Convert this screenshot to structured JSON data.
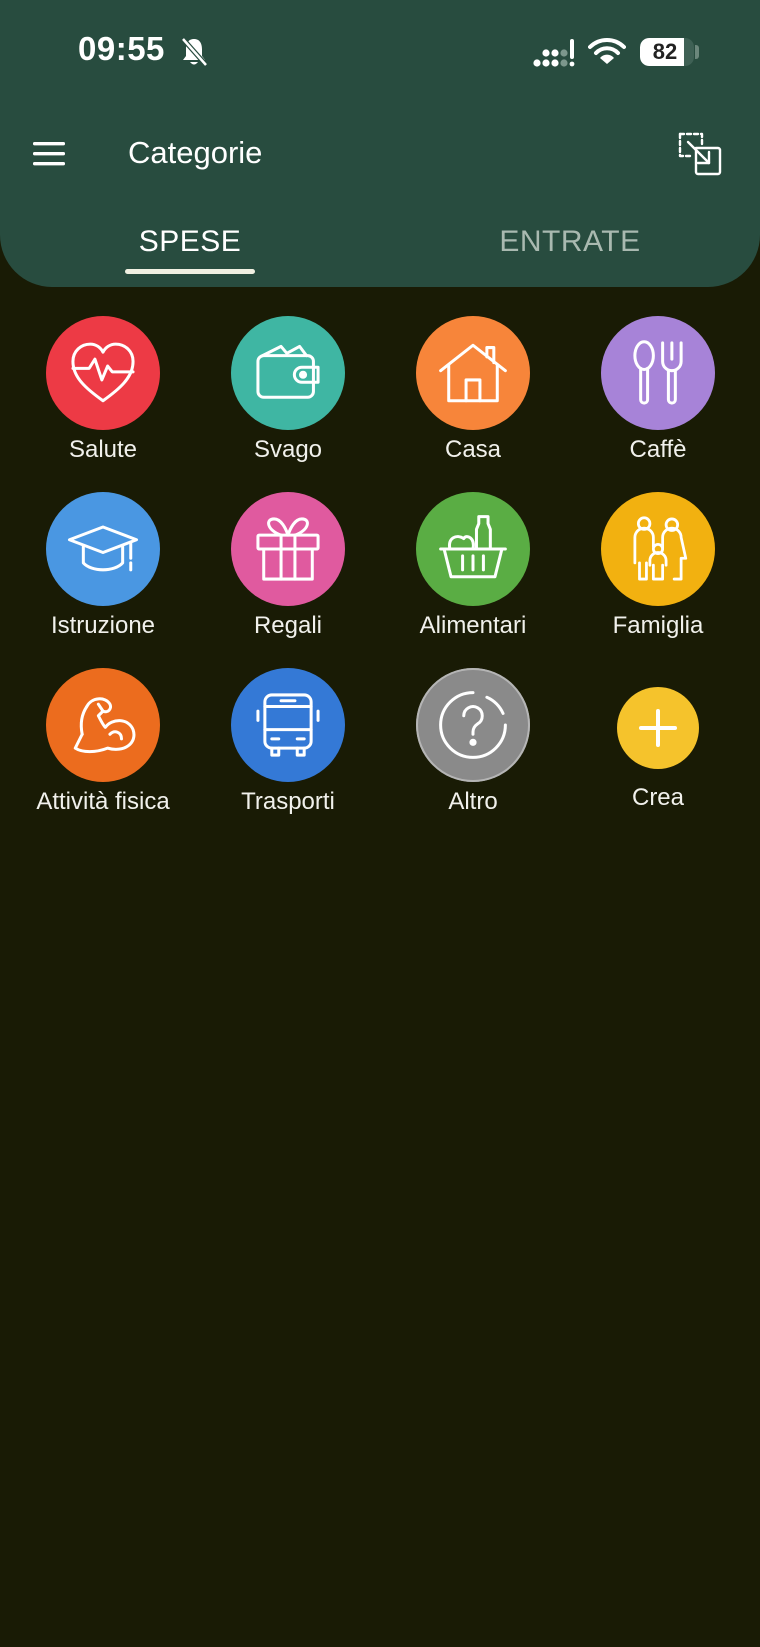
{
  "status_bar": {
    "time": "09:55",
    "battery": "82",
    "battery_level": 0.82,
    "icons": [
      "bell-off-icon",
      "signal-icon",
      "wifi-icon",
      "battery-icon"
    ]
  },
  "header": {
    "title": "Categorie",
    "menu_icon": "hamburger-menu-icon",
    "action_icon": "transfer-icon"
  },
  "tabs": [
    {
      "label": "SPESE",
      "selected": true
    },
    {
      "label": "ENTRATE",
      "selected": false
    }
  ],
  "categories": [
    {
      "label": "Salute",
      "icon": "heart-pulse-icon",
      "color": "#ed3a45"
    },
    {
      "label": "Svago",
      "icon": "wallet-icon",
      "color": "#3fb6a3"
    },
    {
      "label": "Casa",
      "icon": "house-icon",
      "color": "#f7853a"
    },
    {
      "label": "Caffè",
      "icon": "spoon-fork-icon",
      "color": "#a783d8"
    },
    {
      "label": "Istruzione",
      "icon": "graduation-cap-icon",
      "color": "#4a97e2"
    },
    {
      "label": "Regali",
      "icon": "gift-icon",
      "color": "#e05a9f"
    },
    {
      "label": "Alimentari",
      "icon": "grocery-basket-icon",
      "color": "#5aad44"
    },
    {
      "label": "Famiglia",
      "icon": "family-icon",
      "color": "#f2b110"
    },
    {
      "label": "Attività fisica",
      "icon": "biceps-icon",
      "color": "#ec6c1e"
    },
    {
      "label": "Trasporti",
      "icon": "bus-icon",
      "color": "#3479d6"
    },
    {
      "label": "Altro",
      "icon": "question-mark-icon",
      "color": "#8a8a8a"
    }
  ],
  "create": {
    "label": "Crea",
    "icon": "plus-icon",
    "color": "#f5c32c"
  },
  "colors": {
    "background": "#191b05",
    "header": "#284c3f",
    "tab_inactive": "#a9b9b0"
  }
}
